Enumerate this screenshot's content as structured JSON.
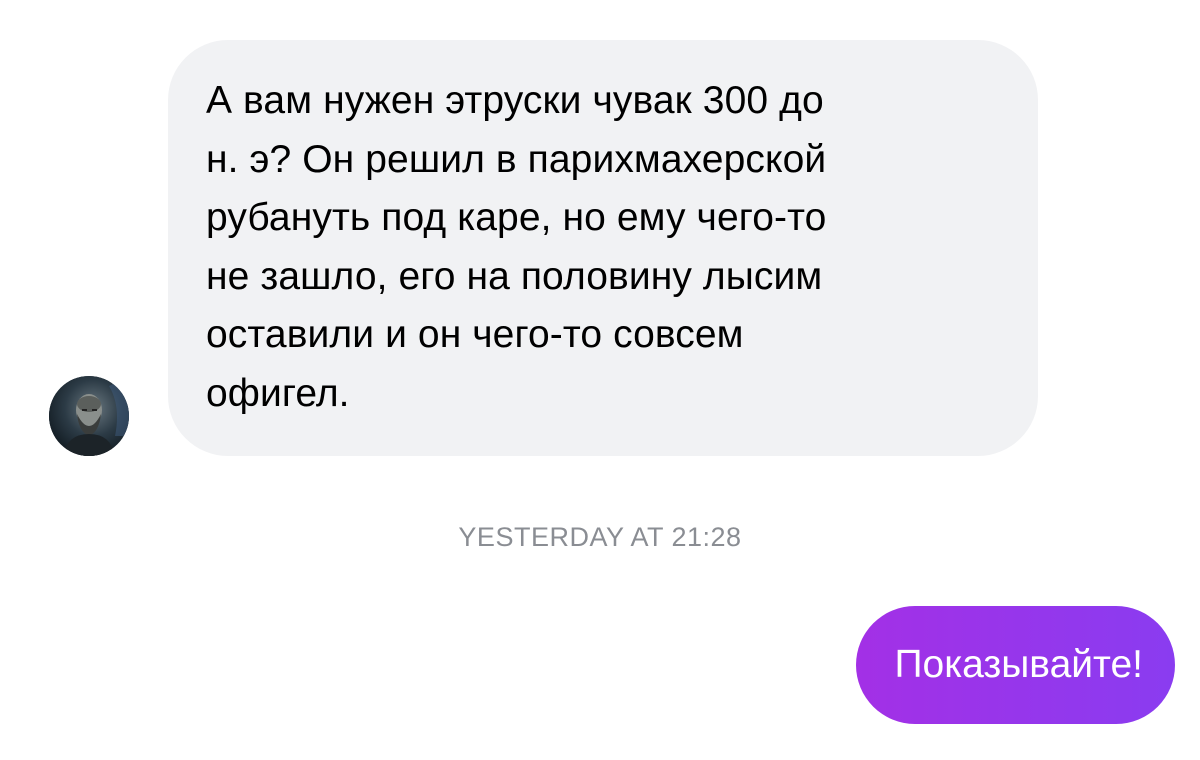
{
  "messages": {
    "incoming": {
      "lines": [
        "А вам нужен этруски чувак 300 до",
        "н. э? Он решил в парихмахерской",
        "рубануть под каре, но ему чего-то",
        "не зашло, его на половину лысим",
        "оставили и он чего-то совсем",
        "офигел."
      ]
    },
    "timestamp": "YESTERDAY AT 21:28",
    "outgoing": {
      "text": "Показывайте!"
    }
  },
  "colors": {
    "incoming_bubble": "#f1f2f4",
    "outgoing_gradient_start": "#a330e6",
    "outgoing_gradient_end": "#8a3cf0",
    "timestamp": "#8a8d93"
  },
  "icons": {
    "avatar": "user-avatar-photo"
  }
}
